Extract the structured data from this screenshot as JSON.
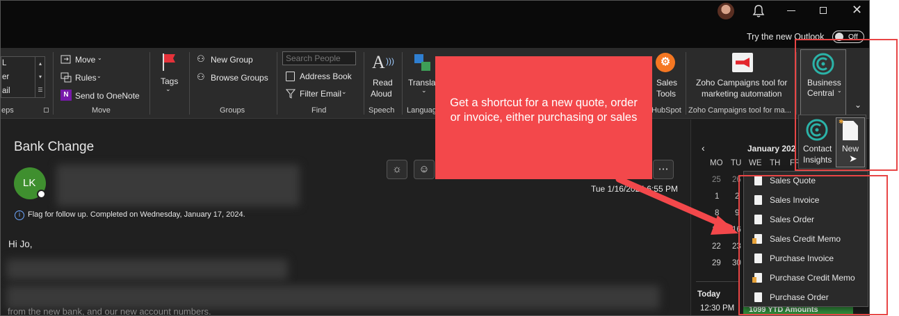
{
  "titlebar": {
    "try_new_outlook": "Try the new Outlook",
    "toggle_state": "Off"
  },
  "ribbon": {
    "quicksteps": {
      "item1": "L",
      "item2": "er",
      "item3": "ail",
      "group_label": "eps"
    },
    "move": {
      "move_label": "Move",
      "rules_label": "Rules",
      "onenote_label": "Send to OneNote",
      "group_label": "Move"
    },
    "tags": {
      "label": "Tags"
    },
    "groups": {
      "new_group": "New Group",
      "browse_groups": "Browse Groups",
      "group_label": "Groups"
    },
    "find": {
      "search_placeholder": "Search People",
      "address_book": "Address Book",
      "filter_email": "Filter Email",
      "group_label": "Find"
    },
    "speech": {
      "read_aloud_1": "Read",
      "read_aloud_2": "Aloud",
      "group_label": "Speech"
    },
    "language": {
      "translate": "Translat",
      "group_label": "Languag"
    },
    "hubspot": {
      "sales_tools_1": "Sales",
      "sales_tools_2": "Tools",
      "group_label": "HubSpot"
    },
    "zoho": {
      "label_1": "Zoho Campaigns tool for",
      "label_2": "marketing automation",
      "group_label": "Zoho Campaigns tool for ma..."
    },
    "bc": {
      "label_1": "Business",
      "label_2": "Central"
    }
  },
  "bc_panel": {
    "contact_insights_1": "Contact",
    "contact_insights_2": "Insights",
    "new_label": "New"
  },
  "new_menu": {
    "items": [
      "Sales Quote",
      "Sales Invoice",
      "Sales Order",
      "Sales Credit Memo",
      "Purchase Invoice",
      "Purchase Credit Memo",
      "Purchase Order"
    ]
  },
  "callout": {
    "text": "Get a shortcut for a new quote, order or invoice, either purchasing or sales"
  },
  "message": {
    "subject": "Bank Change",
    "avatar_initials": "LK",
    "date": "Tue 1/16/2024 6:55 PM",
    "flag_info": "Flag for follow up.  Completed on Wednesday, January 17, 2024.",
    "greeting": "Hi Jo,",
    "partial_line": "from the new bank, and our new account numbers."
  },
  "calendar": {
    "month": "January 202",
    "weekdays": [
      "MO",
      "TU",
      "WE",
      "TH",
      "FR"
    ],
    "col_mo": [
      "25",
      "1",
      "8",
      "15",
      "22",
      "29"
    ],
    "col_tu": [
      "26",
      "2",
      "9",
      "16",
      "23",
      "30"
    ],
    "today_label": "Today",
    "event_time": "12:30 PM",
    "event_title": "1099 YTD Amounts"
  },
  "colors": {
    "callout": "#f3484b",
    "highlight_border": "#e84545",
    "avatar": "#3f8f2f",
    "event": "#2f8a3a"
  }
}
